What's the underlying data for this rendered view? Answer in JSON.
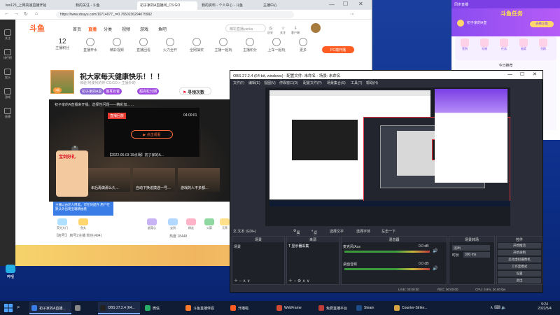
{
  "browser": {
    "tabs": [
      {
        "label": "lwx123_上网高速直播开始"
      },
      {
        "label": "我的关注 - 斗鱼"
      },
      {
        "label": "初子家的A直播间_CS:GO"
      },
      {
        "label": "我的资料 - 个人中心 - 斗鱼"
      },
      {
        "label": "主播中心"
      }
    ],
    "url": "https://www.douyu.com/10714077_r=0.7650236294075992",
    "nav": {
      "logo": "斗鱼",
      "items": [
        "首页",
        "直播",
        "分类",
        "视频",
        "游戏",
        "鱼吧"
      ],
      "search_placeholder": "精彩直播yanka",
      "right_icons": [
        "历史",
        "关注",
        "客户端"
      ]
    },
    "topics": [
      {
        "value": "12",
        "label": "主播积分"
      },
      {
        "label": "直播开水"
      },
      {
        "label": "精彩视频"
      },
      {
        "label": "直播回看"
      },
      {
        "label": "火力全开"
      },
      {
        "label": "全网抽奖"
      },
      {
        "label": "主播一起玩"
      },
      {
        "label": "主播积分"
      },
      {
        "label": "上车一起玩"
      },
      {
        "label": "更多"
      }
    ],
    "pc_button": "PC端开播",
    "sidebar": [
      "关注",
      "排行榜",
      "娱乐",
      "游戏",
      "直播"
    ],
    "streamer": {
      "title": "祝大家每天健康快乐！！！",
      "room_meta": "体验  阿波列的传  CS:GO > 主播外的",
      "tag1": "初子家的A皇",
      "tag2": "猫耳奶爸",
      "tag3": "超高粒分期",
      "follow": "寻领次数",
      "badge": "5级",
      "announce": "初子家的A直播来开播。选择性问题——精彩加……"
    },
    "player": {
      "ended_tag": "直播回放",
      "duration": "04:00:01",
      "play_label": "▶ 点击观看",
      "caption": "【2022-05-03 19点场】初子家的A...",
      "thumbs": [
        "年后再做那么久…",
        "自动下换追摸选一号…",
        "游戏的人不多都…"
      ]
    },
    "promo": {
      "title": "宝剑好礼",
      "note": "主播以由老人用笔，可在的提升\n用户在默认外出现宝箱精拍看"
    },
    "gifts": [
      "荧光大门",
      "鱼丸",
      "超宠心",
      "宝剑",
      "粉丝",
      "火箭",
      "元宵"
    ],
    "room_info": "【房号】 房号2主播 粉丝(494)",
    "heat": "热度 18448"
  },
  "right_panel": {
    "top": "同步直播",
    "banner": "斗鱼任务",
    "user": "初子家的A皇",
    "level": "去看斗鱼",
    "cells": [
      "签到",
      "礼物",
      "任务",
      "抽奖",
      "兑换"
    ],
    "section": "今日推荐"
  },
  "obs": {
    "title": "OBS 27.2.4 (64-bit, windows) - 配置文件: 未命名 - 场景: 未命名",
    "menu": [
      "文件(F)",
      "编辑(E)",
      "视图(V)",
      "停靠窗口(D)",
      "配置文件(P)",
      "场景集合(S)",
      "工具(T)",
      "帮助(H)"
    ],
    "source_bar": {
      "label": "文 文本 (GDI+)",
      "props": "属性",
      "filters": "滤镜",
      "choose": "选择文字",
      "choose2": "选择字体",
      "more": "左击一下"
    },
    "docks": {
      "scenes": {
        "title": "场景",
        "items": [
          "场景"
        ]
      },
      "sources": {
        "title": "来源",
        "items": [
          "显示器采集"
        ]
      },
      "mixer": {
        "title": "混音器",
        "tracks": [
          {
            "name": "麦克风/Aux",
            "db": "0.0 dB"
          },
          {
            "name": "桌面音频",
            "db": "0.0 dB"
          }
        ]
      },
      "transitions": {
        "title": "场景转场",
        "type": "淡出",
        "duration_label": "时长",
        "duration": "300 ms"
      },
      "controls": {
        "title": "控件",
        "buttons": [
          "开始推流",
          "开始录制",
          "启动虚拟摄像机",
          "工作室模式",
          "设置",
          "退出"
        ]
      }
    },
    "status": {
      "live": "LIVE: 00:00:00",
      "rec": "REC: 00:00:00",
      "cpu": "CPU: 0.8%, 30.00 fps"
    }
  },
  "desktop": {
    "side_chip": "哔哩"
  },
  "taskbar": {
    "items": [
      {
        "label": "初子家的A直播...",
        "color": "#3a7de6"
      },
      {
        "label": "",
        "color": "#888888"
      },
      {
        "label": "OBS 27.2.4 (64...",
        "color": "#222222"
      },
      {
        "label": "微信",
        "color": "#2aae67"
      },
      {
        "label": "斗鱼直播伴侣",
        "color": "#ff7a2a"
      },
      {
        "label": "开播啦",
        "color": "#ff5d23"
      },
      {
        "label": "WebFrame",
        "color": "#d14a32"
      },
      {
        "label": "免费直播平台",
        "color": "#c03a3a"
      },
      {
        "label": "Steam",
        "color": "#1b4c86"
      },
      {
        "label": "Counter-Strike...",
        "color": "#d9a441"
      }
    ],
    "time": "9:24",
    "date": "2022/5/4"
  }
}
